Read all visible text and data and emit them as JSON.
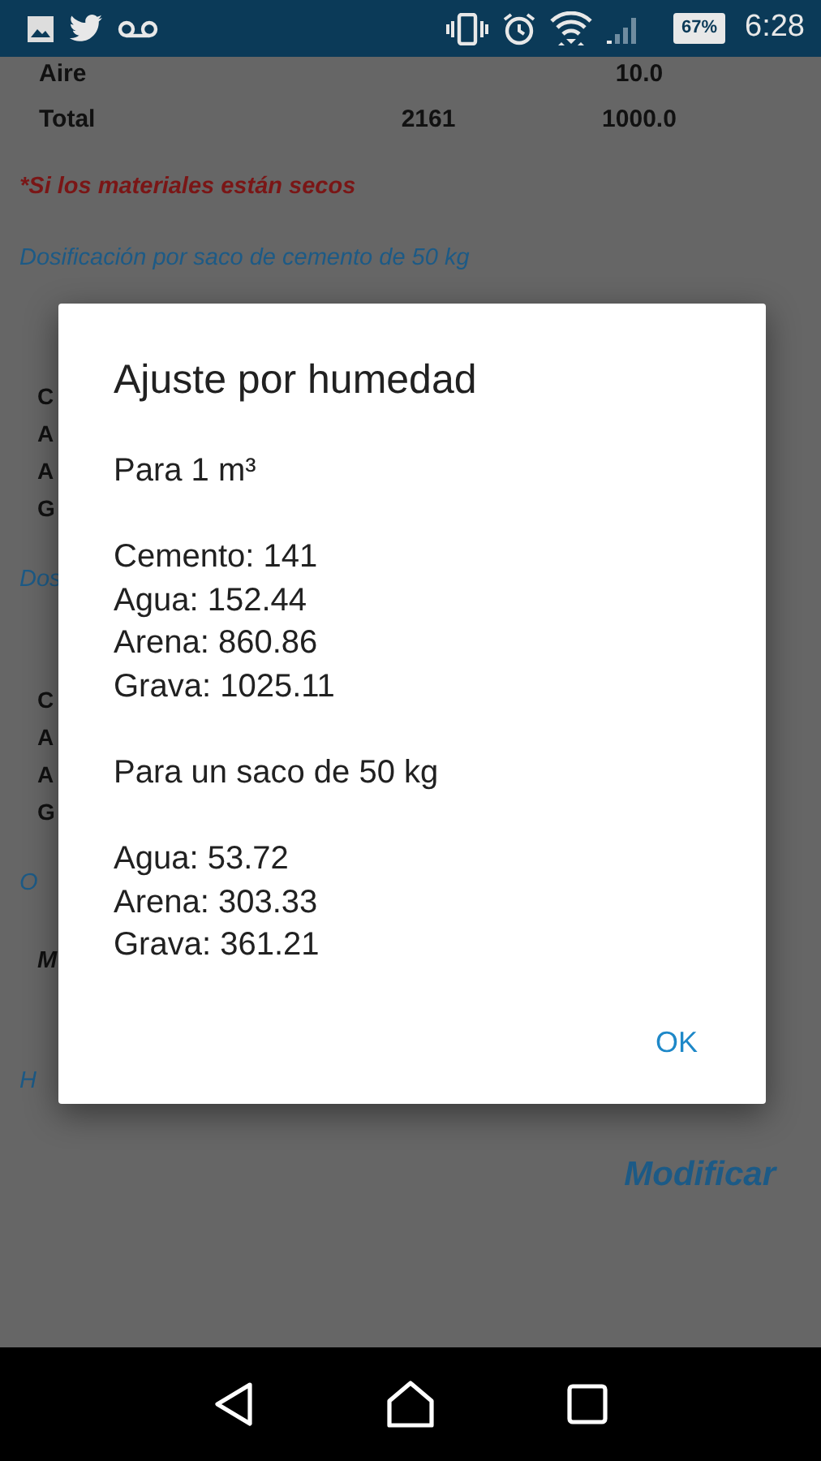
{
  "status_bar": {
    "battery": "67%",
    "time": "6:28"
  },
  "background": {
    "table_rows": [
      {
        "label": "Aire",
        "column_2": "",
        "column_3": "10.0"
      },
      {
        "label": "Total",
        "column_2": "2161",
        "column_3": "1000.0"
      }
    ],
    "note": "*Si los materiales están secos",
    "section_title": "Dosificación por saco de cemento de 50 kg",
    "blocks": [
      {
        "kind": "rows",
        "texts": [
          "C",
          "A",
          "A",
          "G"
        ]
      },
      {
        "kind": "section",
        "texts": [
          "Dos"
        ]
      },
      {
        "kind": "rows",
        "texts": [
          "C",
          "A",
          "A",
          "G"
        ]
      },
      {
        "kind": "section",
        "texts": [
          "O"
        ]
      },
      {
        "kind": "bold",
        "texts": [
          "M"
        ]
      },
      {
        "kind": "section",
        "texts": [
          "H"
        ]
      }
    ],
    "modify_link": "Modificar"
  },
  "dialog": {
    "title": "Ajuste por humedad",
    "sections": [
      {
        "heading": "Para 1 m³",
        "lines": [
          "Cemento: 141",
          "Agua: 152.44",
          "Arena: 860.86",
          "Grava: 1025.11"
        ]
      },
      {
        "heading": "Para un saco de 50 kg",
        "lines": [
          "Agua: 53.72",
          "Arena: 303.33",
          "Grava: 361.21"
        ]
      }
    ],
    "button": "OK"
  }
}
